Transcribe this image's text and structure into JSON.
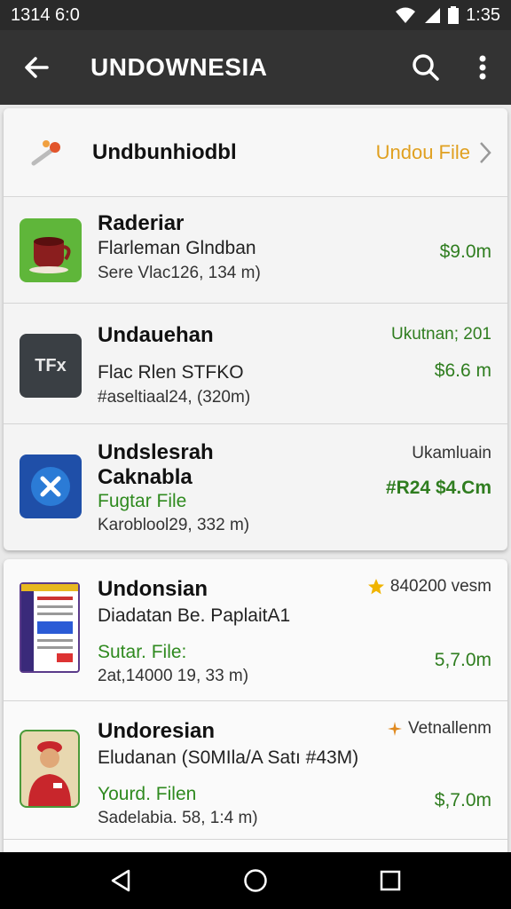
{
  "status_bar": {
    "left_time": "1314 6:0",
    "right_time": "1:35"
  },
  "app_bar": {
    "title": "UNDOWNESIA"
  },
  "header": {
    "title": "Undbunhiodbl",
    "link": "Undou File"
  },
  "card1": [
    {
      "name": "Raderiar",
      "line1": "Flarleman Glndban",
      "meta": "Sere Vlac126, 134 m)",
      "price": "$9.0m"
    },
    {
      "name": "Undauehan",
      "top_right": "Ukutnan; 201",
      "icon_text": "TFx",
      "line1": "Flac Rlen STFKO",
      "meta": "#aseltiaal24, (320m)",
      "price": "$6.6 m"
    },
    {
      "name": "Undslesrah",
      "name2": "Caknabla",
      "top_right": "Ukamluain",
      "green": "Fugtar File",
      "meta": "Karoblool29, 332 m)",
      "price": "#R24 $4.Cm"
    }
  ],
  "card2": [
    {
      "name": "Undonsian",
      "tag": "840200 vesm",
      "line1": "Diadatan Be. PaplaitA1",
      "green": "Sutar. File:",
      "meta": "2at,14000 19, 33 m)",
      "price": "5,7.0m"
    },
    {
      "name": "Undoresian",
      "tag": "Vetnallenm",
      "line1": "Eludanan (S0MIla/A Satı #43M)",
      "green": "Yourd. Filen",
      "meta": "Sadelabia. 58, 1:4 m)",
      "price": "$,7.0m"
    }
  ],
  "colors": {
    "appbar": "#333333",
    "green": "#2f8a1f",
    "accent": "#e0a020"
  },
  "icons": [
    "back-arrow-icon",
    "search-icon",
    "more-vert-icon",
    "wifi-icon",
    "signal-icon",
    "battery-icon",
    "star-icon",
    "chevron-right-icon",
    "nav-back-icon",
    "nav-home-icon",
    "nav-recents-icon"
  ]
}
